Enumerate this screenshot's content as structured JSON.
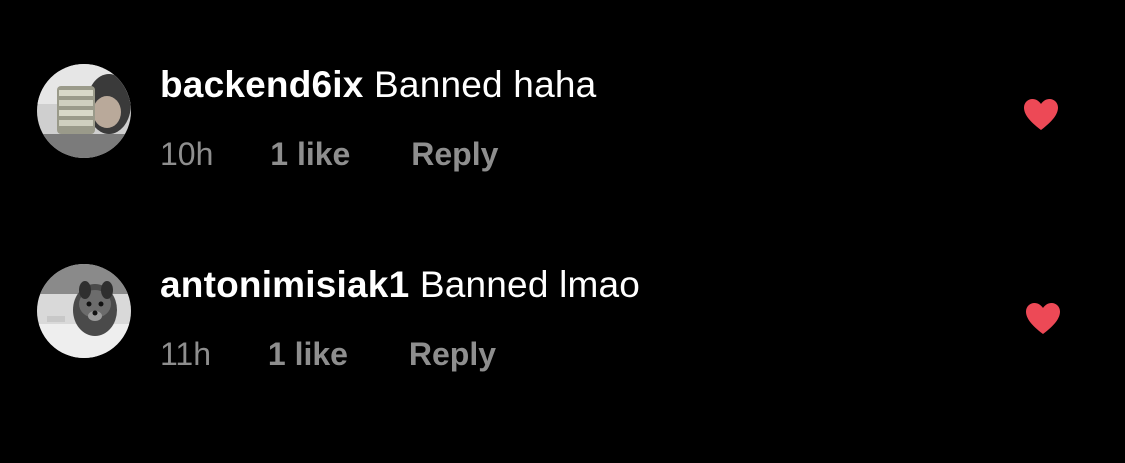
{
  "comments": [
    {
      "username": "backend6ix",
      "text": "Banned haha",
      "timestamp": "10h",
      "likes": "1 like",
      "reply_label": "Reply",
      "liked": true,
      "avatar_icon": "avatar-person-holding-cash"
    },
    {
      "username": "antonimisiak1",
      "text": "Banned lmao",
      "timestamp": "11h",
      "likes": "1 like",
      "reply_label": "Reply",
      "liked": true,
      "avatar_icon": "avatar-dog-in-snow"
    }
  ],
  "colors": {
    "background": "#000000",
    "primary_text": "#ffffff",
    "secondary_text": "#8e8e8e",
    "heart": "#ed4956"
  }
}
